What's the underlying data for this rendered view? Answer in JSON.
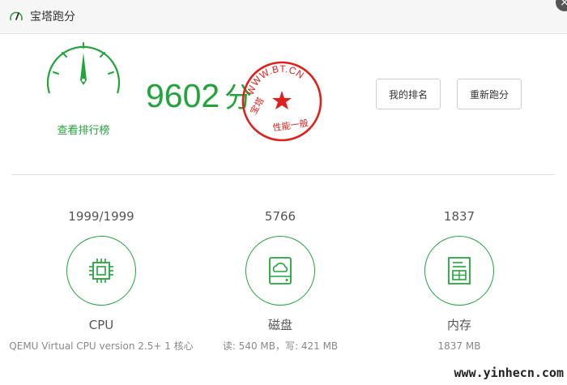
{
  "window": {
    "title": "宝塔跑分",
    "close_glyph": "×"
  },
  "score": {
    "value": "9602",
    "unit": "分",
    "ranking_link": "查看排行榜"
  },
  "stamp": {
    "outer_text": "WWW.BT.CN",
    "left_text": "宝塔",
    "bottom_text": "性能一般",
    "color": "#e0201c"
  },
  "buttons": {
    "my_rank": "我的排名",
    "rerun": "重新跑分"
  },
  "metrics": [
    {
      "value": "1999/1999",
      "name": "CPU",
      "detail": "QEMU Virtual CPU version 2.5+ 1 核心",
      "icon": "cpu-chip-icon"
    },
    {
      "value": "5766",
      "name": "磁盘",
      "detail": "读: 540 MB，写: 421 MB",
      "icon": "disk-cloud-icon"
    },
    {
      "value": "1837",
      "name": "内存",
      "detail": "1837 MB",
      "icon": "memory-document-icon"
    }
  ],
  "watermark": "www.yinhecn.com",
  "colors": {
    "accent": "#20a53a",
    "stamp": "#e0201c"
  }
}
